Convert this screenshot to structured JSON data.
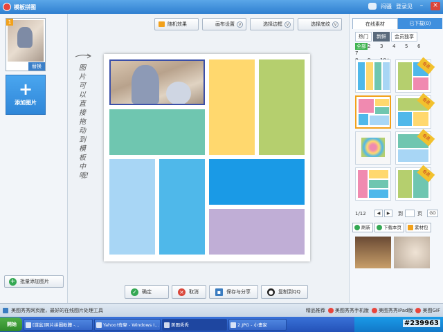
{
  "titlebar": {
    "title": "模板拼图",
    "user": "闷骚",
    "login": "登录见"
  },
  "left": {
    "thumb_number": "1",
    "thumb_replace": "替换",
    "add_picture": "添加图片",
    "plus": "+",
    "batch_add": "批量添加图片"
  },
  "toolbar": {
    "random": "随机效果",
    "canvas_settings": "画布设置",
    "border": "选择边框",
    "shading": "选择底纹"
  },
  "hint": "图片可以直接拖动到模板中哦!",
  "layout_colors": {
    "yellow": "#ffd86e",
    "green": "#b5cf6e",
    "teal": "#6fc6b0",
    "lightblue": "#a8d6f5",
    "blue": "#4fb8ea",
    "brightblue": "#1a9ae6",
    "purple": "#c0aed6"
  },
  "bottom": {
    "ok": "确定",
    "cancel": "取消",
    "save_share": "保存与分享",
    "share_qq": "复制到QQ"
  },
  "right": {
    "tabs": [
      "在线素材",
      "已下载(0)"
    ],
    "subtabs": [
      "热门",
      "新鲜",
      "会员独享"
    ],
    "counts": [
      "全部",
      "2",
      "3",
      "4",
      "5",
      "6",
      "7",
      "8",
      "9",
      "10+"
    ],
    "vip_label": "会员",
    "page": "1/12",
    "page_goto": "到",
    "page_unit": "页",
    "go": "GO",
    "refresh": "刷新",
    "download_page": "下载本页",
    "material_pack": "素材包"
  },
  "statusbar": {
    "news": "美图秀秀网页版，最好的在线图片处理工具",
    "links": [
      "精品推荐",
      "美图秀秀手机版",
      "美图秀秀iPad版",
      "美图GIF"
    ]
  },
  "taskbar": {
    "start": "開始",
    "tasks": [
      "[謀盆]照片拼圖軟體 -...",
      "Yahoo!奇摩 - Windows I...",
      "美图秀秀",
      "2.JPG - 小畫家"
    ],
    "watermark": "#239963"
  }
}
